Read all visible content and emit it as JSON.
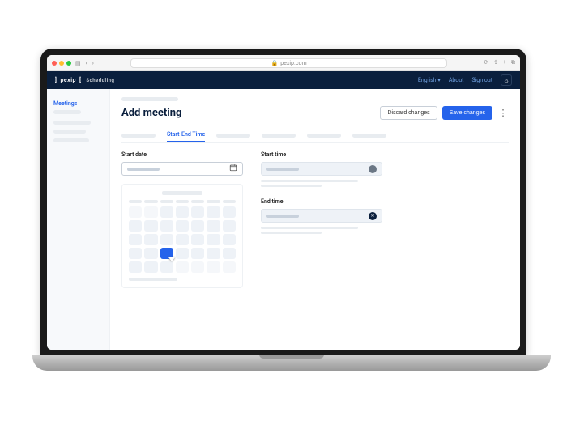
{
  "browser": {
    "url": "pexip.com",
    "lock": "🔒"
  },
  "header": {
    "brand": "pexip",
    "product": "Scheduling",
    "links": {
      "english": "English",
      "about": "About",
      "signout": "Sign out"
    }
  },
  "sidebar": {
    "meetings": "Meetings"
  },
  "page": {
    "title": "Add meeting",
    "discard": "Discard changes",
    "save": "Save changes"
  },
  "tabs": {
    "active": "Start-End Time"
  },
  "form": {
    "start_date_label": "Start date",
    "start_time_label": "Start time",
    "end_time_label": "End time",
    "calendar_icon": "📅"
  }
}
